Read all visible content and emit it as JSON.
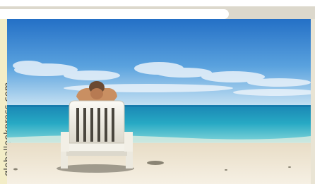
{
  "photo_credit": "globallookpress.com",
  "scene": {
    "sky_top": "#2f7fd0",
    "sky_bottom": "#b9daf0",
    "sea": "#1a9fc0",
    "sea_light": "#55c4d6",
    "sand": "#f1e9d8",
    "chair": "#f7f5ef",
    "chair_shadow": "#6e6a60"
  }
}
